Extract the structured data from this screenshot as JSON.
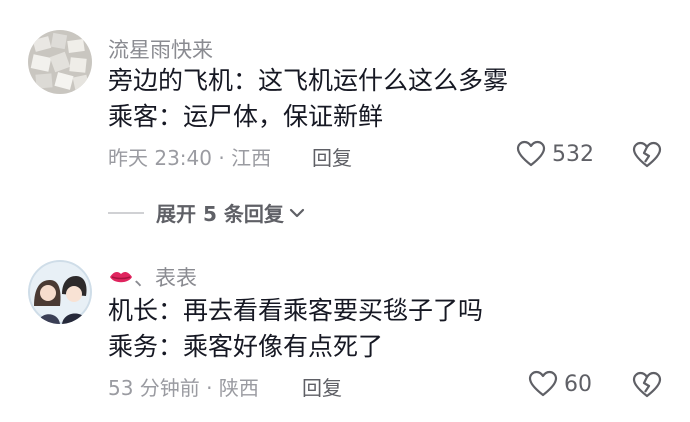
{
  "comments": [
    {
      "username": "流星雨快来",
      "lines": [
        "旁边的飞机：这飞机运什么这么多雾",
        "乘客：运尸体，保证新鲜"
      ],
      "time": "昨天 23:40",
      "location": "江西",
      "reply_label": "回复",
      "likes": "532",
      "icons": {
        "like": "heart-outline-icon",
        "dislike": "broken-heart-icon"
      }
    },
    {
      "username_emoji": "lips-emoji",
      "username_sep": "、",
      "username": "表表",
      "lines": [
        "机长：再去看看乘客要买毯子了吗",
        "乘务：乘客好像有点死了"
      ],
      "time": "53 分钟前",
      "location": "陕西",
      "reply_label": "回复",
      "likes": "60",
      "icons": {
        "like": "heart-outline-icon",
        "dislike": "broken-heart-icon"
      }
    }
  ],
  "expand_replies": {
    "label": "展开 5 条回复",
    "icon": "chevron-down-icon"
  },
  "colors": {
    "text": "#161823",
    "meta": "#9a9ba1",
    "action": "#5f6066"
  }
}
